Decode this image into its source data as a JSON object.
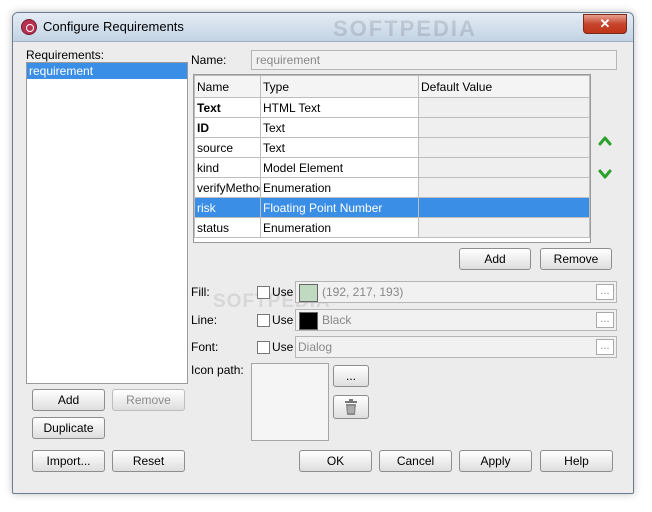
{
  "window": {
    "title": "Configure Requirements",
    "close": "✕"
  },
  "watermark": "SOFTPEDIA",
  "requirements": {
    "label": "Requirements:",
    "items": [
      "requirement"
    ]
  },
  "name": {
    "label": "Name:",
    "value": "requirement"
  },
  "attributes": {
    "columns": [
      "Name",
      "Type",
      "Default Value"
    ],
    "rows": [
      {
        "name": "Text",
        "type": "HTML Text",
        "default": ""
      },
      {
        "name": "ID",
        "type": "Text",
        "default": ""
      },
      {
        "name": "source",
        "type": "Text",
        "default": ""
      },
      {
        "name": "kind",
        "type": "Model Element",
        "default": ""
      },
      {
        "name": "verifyMethod",
        "type": "Enumeration",
        "default": ""
      },
      {
        "name": "risk",
        "type": "Floating Point Number",
        "default": ""
      },
      {
        "name": "status",
        "type": "Enumeration",
        "default": ""
      }
    ],
    "selected_row": 5
  },
  "icons": {
    "move_up": "chevron-up-icon",
    "move_down": "chevron-down-icon",
    "delete": "trash-icon"
  },
  "buttons": {
    "add": "Add",
    "remove": "Remove",
    "duplicate": "Duplicate",
    "import": "Import...",
    "reset": "Reset",
    "ok": "OK",
    "cancel": "Cancel",
    "apply": "Apply",
    "help": "Help",
    "browse": "..."
  },
  "style": {
    "fill": {
      "label": "Fill:",
      "use": "Use",
      "value": "(192, 217, 193)",
      "color": "#c0d9c1"
    },
    "line": {
      "label": "Line:",
      "use": "Use",
      "value": "Black",
      "color": "#000000"
    },
    "font": {
      "label": "Font:",
      "use": "Use",
      "value": "Dialog"
    },
    "icon_path": {
      "label": "Icon path:"
    }
  },
  "colors": {
    "selection": "#3a8ee6",
    "accent_arrow": "#2aa12a"
  }
}
